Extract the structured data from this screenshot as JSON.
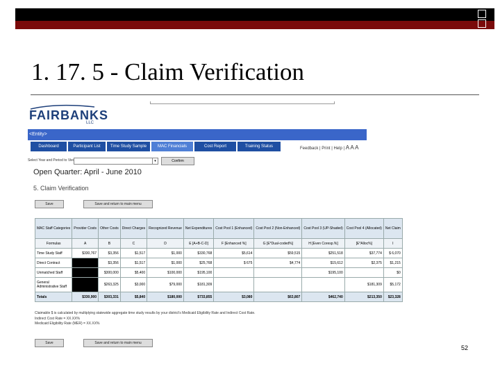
{
  "slide": {
    "title": "1. 17. 5 - Claim Verification",
    "page_number": "52"
  },
  "app": {
    "logo_text": "FAIRBANKS",
    "logo_sub": "LLC",
    "entity": "<Entity>",
    "nav_tabs": [
      "Dashboard",
      "Participant List",
      "Time Study Sample",
      "MAC Financials",
      "Cost Report",
      "Training Status"
    ],
    "active_tab": "MAC Financials",
    "feedback_links": "Feedback | Print | Help |",
    "font_size_glyph": "A A A"
  },
  "selector": {
    "label": "Select Year and Period to View",
    "value": "",
    "confirm_label": "Confirm"
  },
  "page": {
    "open_quarter": "Open Quarter: April - June 2010",
    "section": "5. Claim Verification",
    "save_label": "Save",
    "save_return_label": "Save and return to main menu"
  },
  "table": {
    "headers": [
      "MAC Staff Categories",
      "Provider Costs",
      "Other Costs",
      "Direct Charges",
      "Recognized Revenue",
      "Net Expenditures",
      "Cost Pool 1 (Enhanced)",
      "Cost Pool 2 (Non-Enhanced)",
      "Cost Pool 3 (UP-Shaded)",
      "Cost Pool 4 (Allocated)",
      "Net Claim"
    ],
    "formula_row": [
      "Formulas",
      "A",
      "B",
      "C",
      "D",
      "E [A+B-C-D]",
      "F [Enhanced %]",
      "G [E*Dual-coded%]",
      "H [Even Coresp.%]",
      "[E*Alloc%]",
      "I"
    ],
    "rows": [
      {
        "cells": [
          "Time Study Staff",
          "$330,767",
          "$3,356",
          "$1,517",
          "$1,000",
          "$330,768",
          "$5,614",
          "$59,515",
          "$251,518",
          "$37,774",
          "$ 6,070"
        ],
        "black": false
      },
      {
        "cells": [
          "Direct Contract",
          "",
          "$3,356",
          "$1,517",
          "$1,000",
          "$25,768",
          "$ 675",
          "$4,774",
          "$15,612",
          "$2,375",
          "$1,215"
        ],
        "black": true
      },
      {
        "cells": [
          "Unmatched Staff",
          "",
          "$300,000",
          "$5,400",
          "$100,000",
          "$195,100",
          "",
          "",
          "$195,100",
          "",
          "$0"
        ],
        "black": true
      },
      {
        "cells": [
          "General Administrative Staff",
          "",
          "$263,325",
          "$3,000",
          "$79,000",
          "$181,309",
          "",
          "",
          "",
          "$181,309",
          "$5,172"
        ],
        "black": true
      }
    ],
    "totals": [
      "Totals",
      "$330,900",
      "$303,331",
      "$5,840",
      "$180,000",
      "$733,855",
      "$3,080",
      "$63,807",
      "$462,740",
      "$213,350",
      "$23,328"
    ]
  },
  "footnotes": [
    "Claimable $ is calculated by multiplying statewide aggregate time study results by your district's Medicaid Eligibility Rate and Indirect Cost Rate.",
    "Indirect Cost Rate = XX.XX%",
    "Medicaid Eligibility Rate (MER) = XX.XX%"
  ]
}
